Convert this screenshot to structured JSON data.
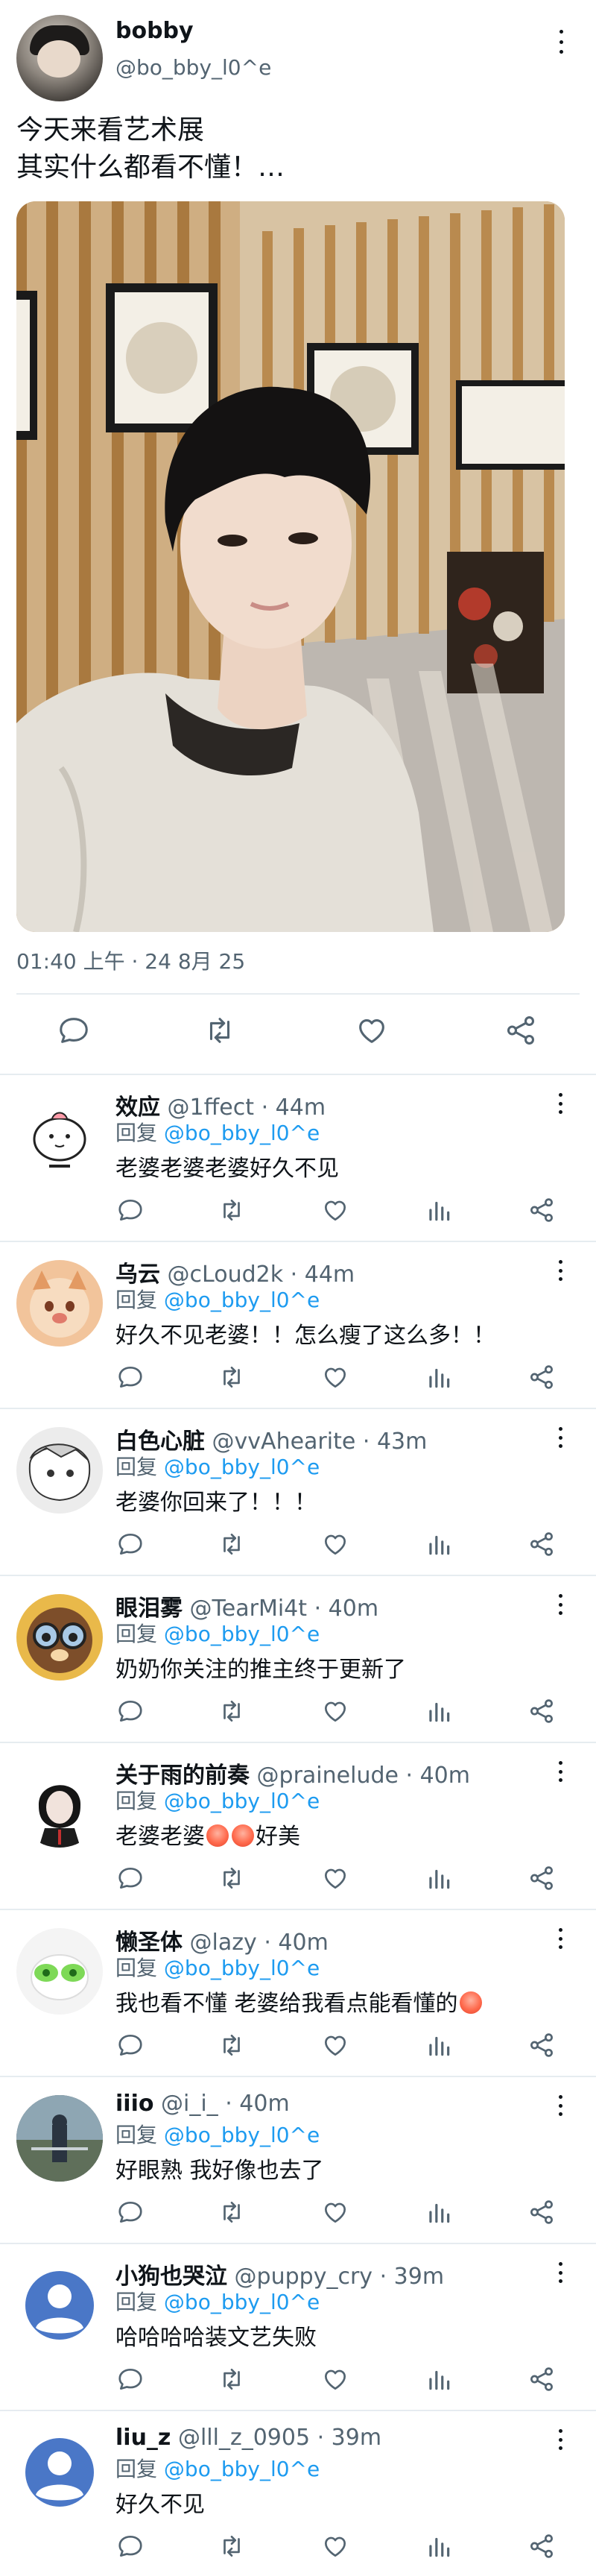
{
  "main_tweet": {
    "author_name": "bobby",
    "author_handle": "@bo_bby_l0^e",
    "text": "今天来看艺术展\n其实什么都看不懂！…",
    "timestamp": "01:40 上午 · 24 8月 25",
    "actions": [
      "reply-icon",
      "retweet-icon",
      "like-icon",
      "share-icon"
    ]
  },
  "reply_label": "回复",
  "reply_to_handle": "@bo_bby_l0^e",
  "replies": [
    {
      "name": "效应",
      "handle": "@1ffect",
      "time": "· 44m",
      "text": "老婆老婆老婆好久不见"
    },
    {
      "name": "乌云",
      "handle": "@cLoud2k",
      "time": "· 44m",
      "text": "好久不见老婆！！怎么瘦了这么多！！"
    },
    {
      "name": "白色心脏",
      "handle": "@vvAhearite",
      "time": "· 43m",
      "text": "老婆你回来了！！！"
    },
    {
      "name": "眼泪雾",
      "handle": "@TearMi4t",
      "time": "· 40m",
      "text": "奶奶你关注的推主终于更新了"
    },
    {
      "name": "关于雨的前奏",
      "handle": "@prainelude",
      "time": "· 40m",
      "text_before": "老婆老婆",
      "text_after": "好美"
    },
    {
      "name": "懒圣体",
      "handle": "@lazy",
      "time": "· 40m",
      "text": "我也看不懂 老婆给我看点能看懂的"
    },
    {
      "name": "iiio",
      "handle": "@i_i_",
      "time": "· 40m",
      "text": "好眼熟 我好像也去了"
    },
    {
      "name": "小狗也哭泣",
      "handle": "@puppy_cry",
      "time": "· 39m",
      "text": "哈哈哈哈装文艺失败"
    },
    {
      "name": "liu_z",
      "handle": "@lll_z_0905",
      "time": "· 39m",
      "text": "好久不见"
    }
  ],
  "colors": {
    "link": "#1d9bf0",
    "secondary_text": "#536471",
    "divider": "#e6ecf0",
    "default_avatar": "#4a77c7"
  }
}
